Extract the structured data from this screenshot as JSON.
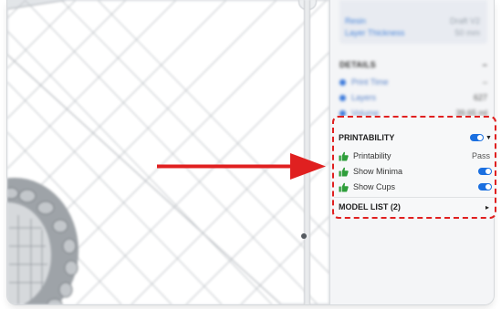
{
  "material": {
    "resin_label": "Resin",
    "resin_value": "Draft V2",
    "layer_thickness_label": "Layer Thickness",
    "layer_thickness_value": "50 mm"
  },
  "details": {
    "title": "DETAILS",
    "collapse_symbol": "–",
    "rows": [
      {
        "label": "Print Time",
        "value": "–"
      },
      {
        "label": "Layers",
        "value": "627"
      },
      {
        "label": "Volume",
        "value": "39.65 ml"
      }
    ]
  },
  "printability": {
    "title": "PRINTABILITY",
    "enabled": true,
    "rows": [
      {
        "label": "Printability",
        "value": "Pass",
        "icon": "thumbs-up-icon"
      },
      {
        "label": "Show Minima",
        "toggle": true,
        "icon": "thumbs-up-icon"
      },
      {
        "label": "Show Cups",
        "toggle": true,
        "icon": "thumbs-up-icon"
      }
    ],
    "model_list_label": "MODEL LIST (2)"
  },
  "colors": {
    "accent": "#1a6fe0",
    "highlight": "#e02020",
    "thumb_green": "#2e9e3a"
  }
}
